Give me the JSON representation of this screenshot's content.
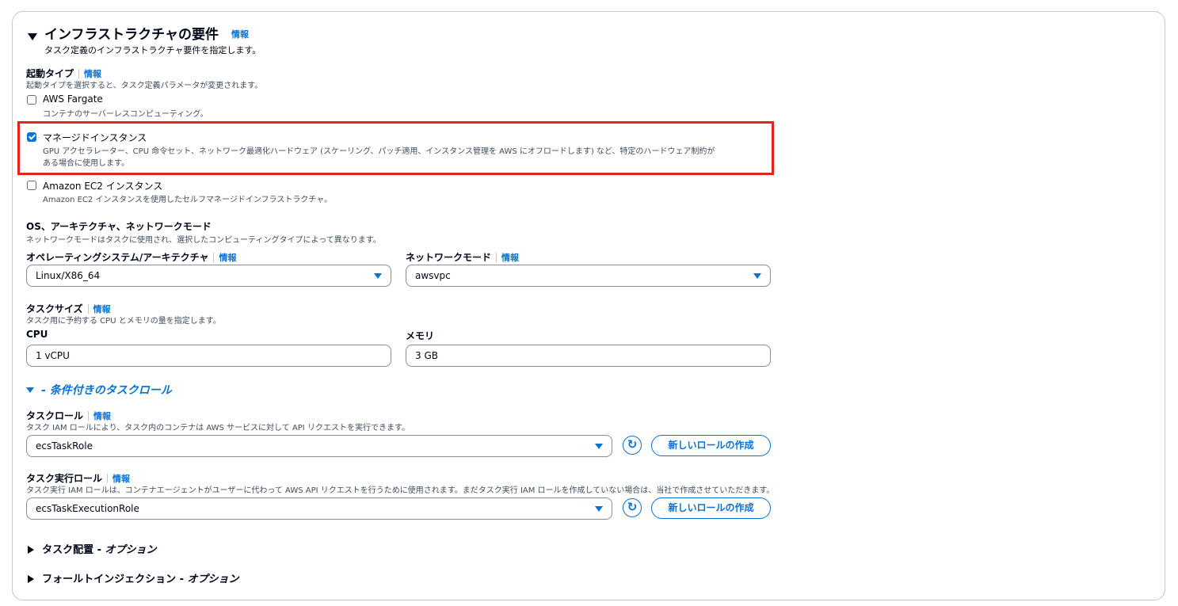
{
  "section": {
    "title": "インフラストラクチャの要件",
    "info": "情報",
    "description": "タスク定義のインフラストラクチャ要件を指定します。"
  },
  "launch_type": {
    "label": "起動タイプ",
    "info": "情報",
    "description": "起動タイプを選択すると、タスク定義パラメータが変更されます。",
    "options": [
      {
        "label": "AWS Fargate",
        "description": "コンテナのサーバーレスコンピューティング。",
        "checked": false
      },
      {
        "label": "マネージドインスタンス",
        "description_line1": "GPU アクセラレーター、CPU 命令セット、ネットワーク最適化ハードウェア (スケーリング、パッチ適用、インスタンス管理を AWS にオフロードします) など、特定のハードウェア制約が",
        "description_line2": "ある場合に使用します。",
        "checked": true
      },
      {
        "label": "Amazon EC2 インスタンス",
        "description": "Amazon EC2 インスタンスを使用したセルフマネージドインフラストラクチャ。",
        "checked": false
      }
    ]
  },
  "os_network": {
    "label": "OS、アーキテクチャ、ネットワークモード",
    "description": "ネットワークモードはタスクに使用され、選択したコンピューティングタイプによって異なります。",
    "os_label": "オペレーティングシステム/アーキテクチャ",
    "os_info": "情報",
    "os_value": "Linux/X86_64",
    "network_label": "ネットワークモード",
    "network_info": "情報",
    "network_value": "awsvpc"
  },
  "task_size": {
    "label": "タスクサイズ",
    "info": "情報",
    "description": "タスク用に予約する CPU とメモリの量を指定します。",
    "cpu_label": "CPU",
    "cpu_value": "1 vCPU",
    "memory_label": "メモリ",
    "memory_value": "3 GB"
  },
  "conditional_roles": {
    "title": "- 条件付きのタスクロール",
    "task_role": {
      "label": "タスクロール",
      "info": "情報",
      "description": "タスク IAM ロールにより、タスク内のコンテナは AWS サービスに対して API リクエストを実行できます。",
      "value": "ecsTaskRole",
      "button": "新しいロールの作成"
    },
    "execution_role": {
      "label": "タスク実行ロール",
      "info": "情報",
      "description": "タスク実行 IAM ロールは、コンテナエージェントがユーザーに代わって AWS API リクエストを行うために使用されます。まだタスク実行 IAM ロールを作成していない場合は、当社で作成させていただきます。",
      "value": "ecsTaskExecutionRole",
      "button": "新しいロールの作成"
    }
  },
  "collapsed_sections": [
    {
      "label": "タスク配置 - ",
      "suffix": "オプション"
    },
    {
      "label": "フォールトインジェクション - ",
      "suffix": "オプション"
    }
  ],
  "colors": {
    "accent": "#0972d3",
    "highlight": "#e1251b",
    "text": "#000716"
  },
  "icons": {
    "refresh": "refresh-icon",
    "expand": "caret-down-icon",
    "collapse": "caret-right-icon"
  }
}
